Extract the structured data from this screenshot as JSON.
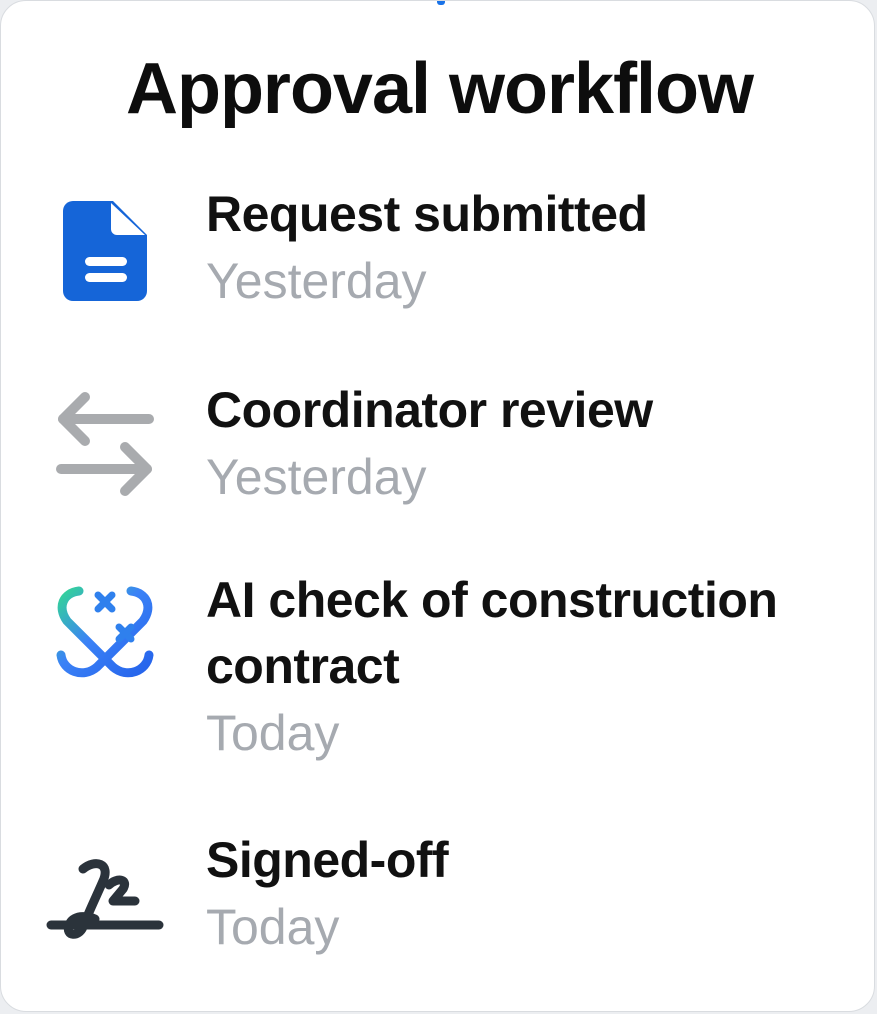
{
  "header": {
    "title": "Approval workflow"
  },
  "steps": [
    {
      "label": "Request submitted",
      "time": "Yesterday",
      "icon": "document-icon",
      "icon_color": "#1565d8"
    },
    {
      "label": "Coordinator review",
      "time": "Yesterday",
      "icon": "swap-arrows-icon",
      "icon_color": "#a9abae"
    },
    {
      "label": "AI check of construction contract",
      "time": "Today",
      "icon": "ai-sparkle-icon",
      "icon_color": "#2f80ed"
    },
    {
      "label": "Signed-off",
      "time": "Today",
      "icon": "signature-icon",
      "icon_color": "#2b333b"
    }
  ]
}
